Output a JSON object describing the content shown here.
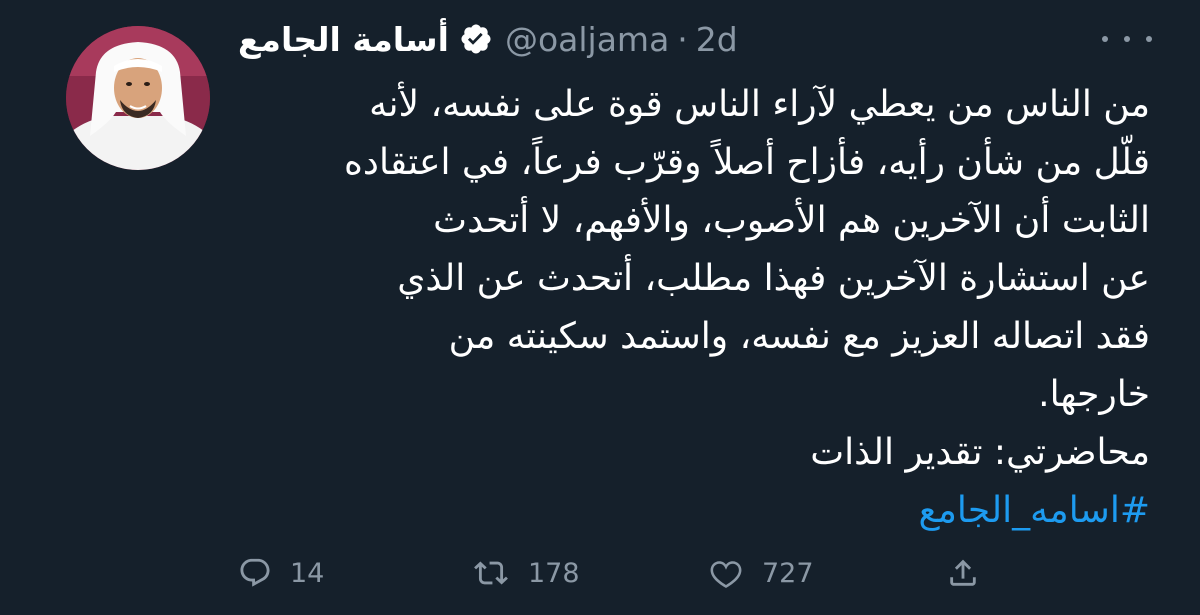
{
  "tweet": {
    "display_name": "أسامة الجامع",
    "handle": "@oaljama",
    "separator": "·",
    "time": "2d",
    "verified_color": "#ffffff",
    "body_lines": [
      "من الناس من يعطي لآراء الناس قوة على نفسه، لأنه",
      "قلّل من شأن رأيه، فأزاح أصلاً وقرّب فرعاً، في اعتقاده",
      "الثابت أن الآخرين هم الأصوب، والأفهم، لا أتحدث",
      "عن استشارة الآخرين فهذا مطلب، أتحدث عن الذي",
      "فقد اتصاله العزيز مع نفسه، واستمد سكينته من",
      "خارجها.",
      "محاضرتي: تقدير الذات"
    ],
    "hashtag": "#اسامه_الجامع",
    "hashtag_color": "#1d9bf0"
  },
  "actions": {
    "reply": {
      "icon": "reply-icon",
      "count": "14"
    },
    "retweet": {
      "icon": "retweet-icon",
      "count": "178"
    },
    "like": {
      "icon": "heart-icon",
      "count": "727"
    },
    "share": {
      "icon": "share-icon"
    }
  },
  "colors": {
    "background": "#15202b",
    "secondary_text": "#8b98a5"
  }
}
